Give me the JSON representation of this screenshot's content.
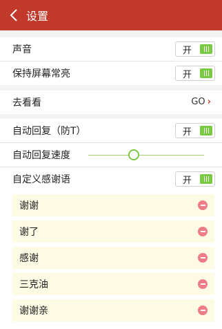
{
  "header": {
    "title": "设置"
  },
  "settings": {
    "sound": {
      "label": "声音",
      "toggle": "开"
    },
    "keep_screen_on": {
      "label": "保持屏幕常亮",
      "toggle": "开"
    }
  },
  "visit": {
    "label": "去看看",
    "action": "GO"
  },
  "auto_reply": {
    "label": "自动回复（防T）",
    "toggle": "开",
    "speed_label": "自动回复速度",
    "speed_value": 0.45,
    "custom_label": "自定义感谢语",
    "custom_toggle": "开"
  },
  "phrases": [
    "谢谢",
    "谢了",
    "感谢",
    "三克油",
    "谢谢亲"
  ],
  "colors": {
    "header": "#c0392b",
    "toggle_on": "#7ac943",
    "phrase_bg": "#fdfbe4",
    "remove": "#ee7c87"
  }
}
